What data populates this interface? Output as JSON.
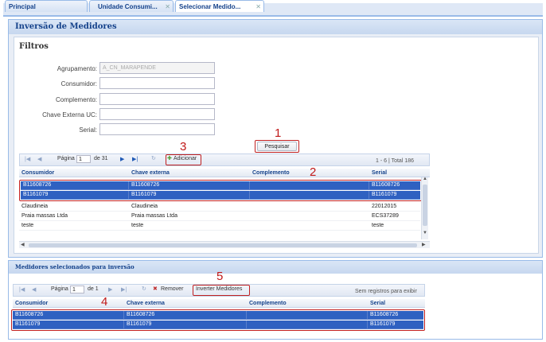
{
  "tabs": [
    {
      "label": "Principal",
      "closable": false
    },
    {
      "label": "Unidade Consumi...",
      "closable": true
    },
    {
      "label": "Selecionar Medido...",
      "closable": true,
      "active": true
    }
  ],
  "page_title": "Inversão de Medidores",
  "filters": {
    "title": "Filtros",
    "fields": [
      {
        "label": "Agrupamento:",
        "value": "A_CN_MARAPENDE",
        "disabled": true
      },
      {
        "label": "Consumidor:",
        "value": ""
      },
      {
        "label": "Complemento:",
        "value": ""
      },
      {
        "label": "Chave Externa UC:",
        "value": ""
      },
      {
        "label": "Serial:",
        "value": ""
      }
    ],
    "search_button": "Pesquisar"
  },
  "callouts": {
    "one": "1",
    "two": "2",
    "three": "3",
    "four": "4",
    "five": "5"
  },
  "top_grid": {
    "pager": {
      "page_label": "Página",
      "page_value": "1",
      "of_label": "de 31",
      "add_button": "Adicionar",
      "summary": "1 - 6 | Total 186"
    },
    "columns": [
      "Consumidor",
      "Chave externa",
      "Complemento",
      "Serial"
    ],
    "rows": [
      {
        "consumidor": "B11608726",
        "chave": "B11608726",
        "complemento": "",
        "serial": "B11608726",
        "selected": true
      },
      {
        "consumidor": "B1161079",
        "chave": "B1161079",
        "complemento": "",
        "serial": "B1161079",
        "selected": true
      },
      {
        "consumidor": "Claudineia",
        "chave": "Claudineia",
        "complemento": "",
        "serial": "22012015",
        "selected": false
      },
      {
        "consumidor": "Praia massas Ltda",
        "chave": "Praia massas Ltda",
        "complemento": "",
        "serial": "ECS37289",
        "selected": false
      },
      {
        "consumidor": "teste",
        "chave": "teste",
        "complemento": "",
        "serial": "teste",
        "selected": false
      }
    ]
  },
  "bottom_grid": {
    "title": "Medidores selecionados para inversão",
    "pager": {
      "page_label": "Página",
      "page_value": "1",
      "of_label": "de 1",
      "remove_button": "Remover",
      "invert_button": "Inverter Medidores",
      "summary": "Sem registros para exibir"
    },
    "columns": [
      "Consumidor",
      "Chave externa",
      "Complemento",
      "Serial"
    ],
    "rows": [
      {
        "consumidor": "B11608726",
        "chave": "B11608726",
        "complemento": "",
        "serial": "B11608726",
        "selected": true
      },
      {
        "consumidor": "B1161079",
        "chave": "B1161079",
        "complemento": "",
        "serial": "B1161079",
        "selected": true
      }
    ]
  },
  "colors": {
    "accent": "#15428b",
    "selection": "#2f61c1",
    "callout": "#c01818"
  }
}
